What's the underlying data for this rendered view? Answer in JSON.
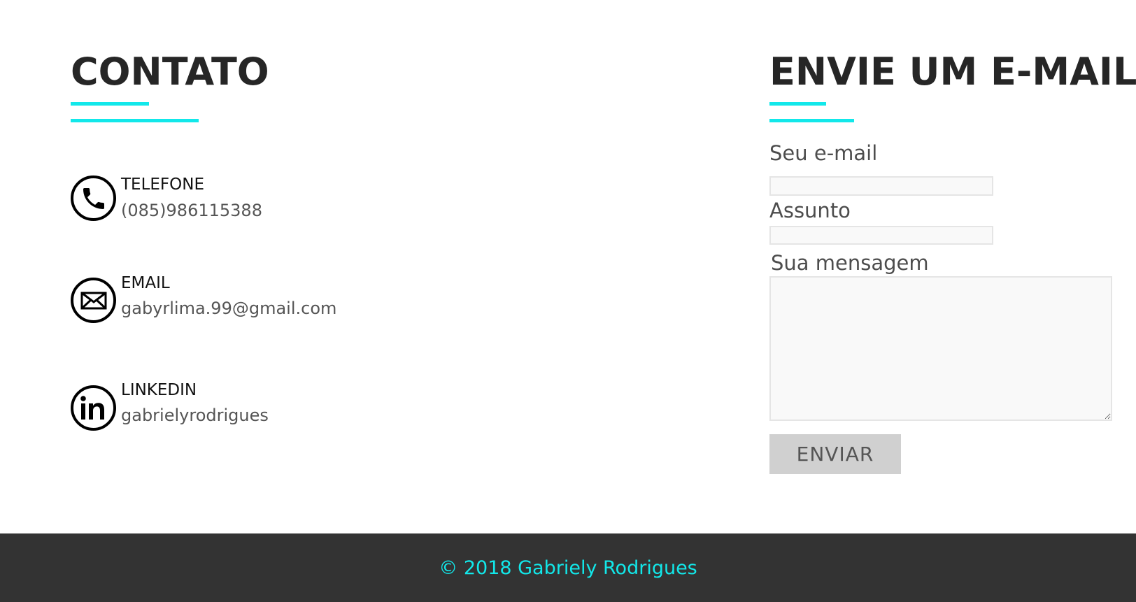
{
  "contato": {
    "title": "CONTATO",
    "items": [
      {
        "icon": "phone-icon",
        "label": "TELEFONE",
        "value": "(085)986115388"
      },
      {
        "icon": "envelope-icon",
        "label": "EMAIL",
        "value": "gabyrlima.99@gmail.com"
      },
      {
        "icon": "linkedin-icon",
        "label": "LINKEDIN",
        "value": "gabrielyrodrigues"
      }
    ]
  },
  "email_form": {
    "title": "ENVIE UM E-MAIL",
    "email_label": "Seu e-mail",
    "email_value": "",
    "subject_label": "Assunto",
    "subject_value": "",
    "message_label": "Sua mensagem",
    "message_value": "",
    "send_label": "ENVIAR"
  },
  "footer": {
    "text": "© 2018 Gabriely Rodrigues"
  },
  "colors": {
    "accent": "#12e8ea",
    "heading": "#262626",
    "footer_bg": "#333333"
  }
}
